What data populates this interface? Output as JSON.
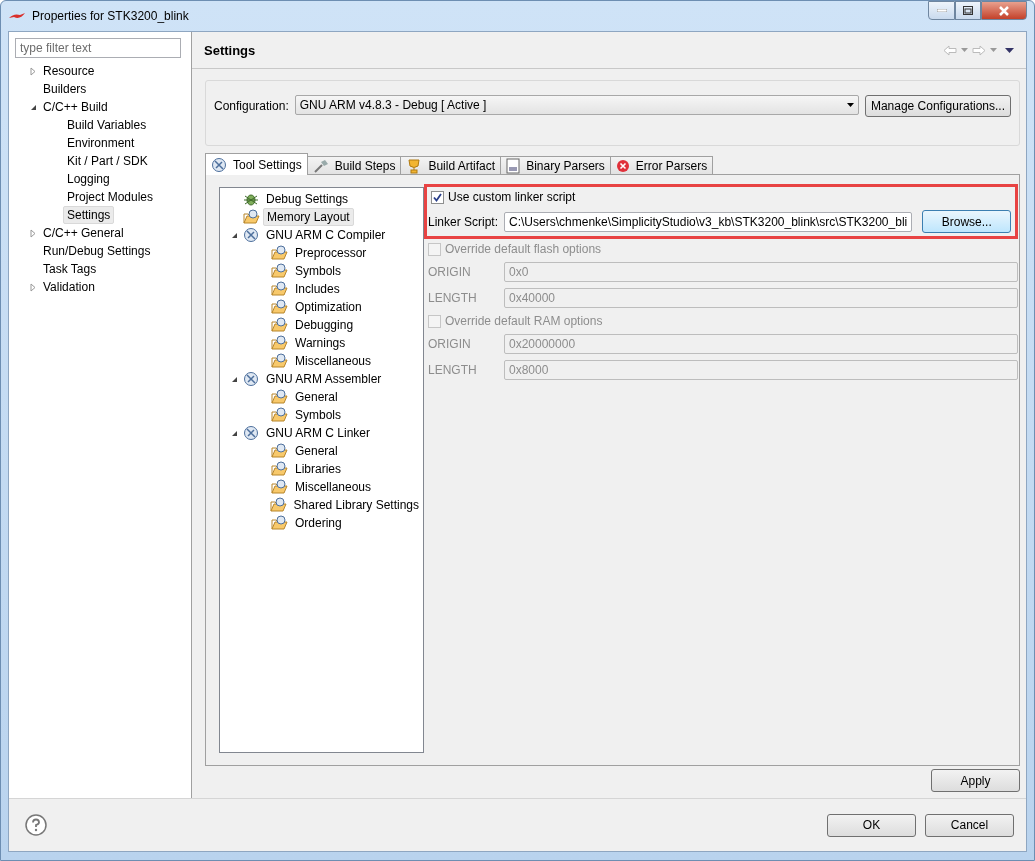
{
  "window": {
    "title": "Properties for STK3200_blink"
  },
  "filter": {
    "placeholder": "type filter text"
  },
  "sidebar": {
    "items": [
      {
        "label": "Resource",
        "expanded": false,
        "selected": false
      },
      {
        "label": "Builders",
        "selected": false
      },
      {
        "label": "C/C++ Build",
        "expanded": true,
        "selected": false,
        "children": [
          {
            "label": "Build Variables",
            "selected": false
          },
          {
            "label": "Environment",
            "selected": false
          },
          {
            "label": "Kit / Part / SDK",
            "selected": false
          },
          {
            "label": "Logging",
            "selected": false
          },
          {
            "label": "Project Modules",
            "selected": false
          },
          {
            "label": "Settings",
            "selected": true
          }
        ]
      },
      {
        "label": "C/C++ General",
        "expanded": false,
        "selected": false
      },
      {
        "label": "Run/Debug Settings",
        "selected": false
      },
      {
        "label": "Task Tags",
        "selected": false
      },
      {
        "label": "Validation",
        "expanded": false,
        "selected": false
      }
    ]
  },
  "page": {
    "title": "Settings"
  },
  "configuration": {
    "label": "Configuration:",
    "value": "GNU ARM v4.8.3 - Debug  [ Active ]",
    "button": "Manage Configurations..."
  },
  "tabs": [
    {
      "label": "Tool Settings",
      "kind": "tool",
      "selected": true
    },
    {
      "label": "Build Steps",
      "kind": "steps",
      "selected": false
    },
    {
      "label": "Build Artifact",
      "kind": "artifact",
      "selected": false
    },
    {
      "label": "Binary Parsers",
      "kind": "binary",
      "selected": false
    },
    {
      "label": "Error Parsers",
      "kind": "error",
      "selected": false
    }
  ],
  "tool_tree": [
    {
      "label": "Debug Settings",
      "kind": "debug",
      "selected": false
    },
    {
      "label": "Memory Layout",
      "kind": "folder",
      "selected": true
    },
    {
      "label": "GNU ARM C Compiler",
      "kind": "tool",
      "expanded": true,
      "selected": false,
      "children": [
        {
          "label": "Preprocessor",
          "kind": "folder",
          "selected": false
        },
        {
          "label": "Symbols",
          "kind": "folder",
          "selected": false
        },
        {
          "label": "Includes",
          "kind": "folder",
          "selected": false
        },
        {
          "label": "Optimization",
          "kind": "folder",
          "selected": false
        },
        {
          "label": "Debugging",
          "kind": "folder",
          "selected": false
        },
        {
          "label": "Warnings",
          "kind": "folder",
          "selected": false
        },
        {
          "label": "Miscellaneous",
          "kind": "folder",
          "selected": false
        }
      ]
    },
    {
      "label": "GNU ARM Assembler",
      "kind": "tool",
      "expanded": true,
      "selected": false,
      "children": [
        {
          "label": "General",
          "kind": "folder",
          "selected": false
        },
        {
          "label": "Symbols",
          "kind": "folder",
          "selected": false
        }
      ]
    },
    {
      "label": "GNU ARM C Linker",
      "kind": "tool",
      "expanded": true,
      "selected": false,
      "children": [
        {
          "label": "General",
          "kind": "folder",
          "selected": false
        },
        {
          "label": "Libraries",
          "kind": "folder",
          "selected": false
        },
        {
          "label": "Miscellaneous",
          "kind": "folder",
          "selected": false
        },
        {
          "label": "Shared Library Settings",
          "kind": "folder",
          "selected": false
        },
        {
          "label": "Ordering",
          "kind": "folder",
          "selected": false
        }
      ]
    }
  ],
  "linker": {
    "highlighted": true,
    "checkbox": {
      "label": "Use custom linker script",
      "checked": true
    },
    "field_label": "Linker Script:",
    "value": "C:\\Users\\chmenke\\SimplicityStudio\\v3_kb\\STK3200_blink\\src\\STK3200_bli",
    "button": "Browse..."
  },
  "overrides": [
    {
      "label": "Override default flash options",
      "checked": false,
      "disabled": true,
      "fields": [
        {
          "label": "ORIGIN",
          "value": "0x0"
        },
        {
          "label": "LENGTH",
          "value": "0x40000"
        }
      ]
    },
    {
      "label": "Override default RAM options",
      "checked": false,
      "disabled": true,
      "fields": [
        {
          "label": "ORIGIN",
          "value": "0x20000000"
        },
        {
          "label": "LENGTH",
          "value": "0x8000"
        }
      ]
    }
  ],
  "buttons": {
    "apply": "Apply",
    "ok": "OK",
    "cancel": "Cancel"
  }
}
